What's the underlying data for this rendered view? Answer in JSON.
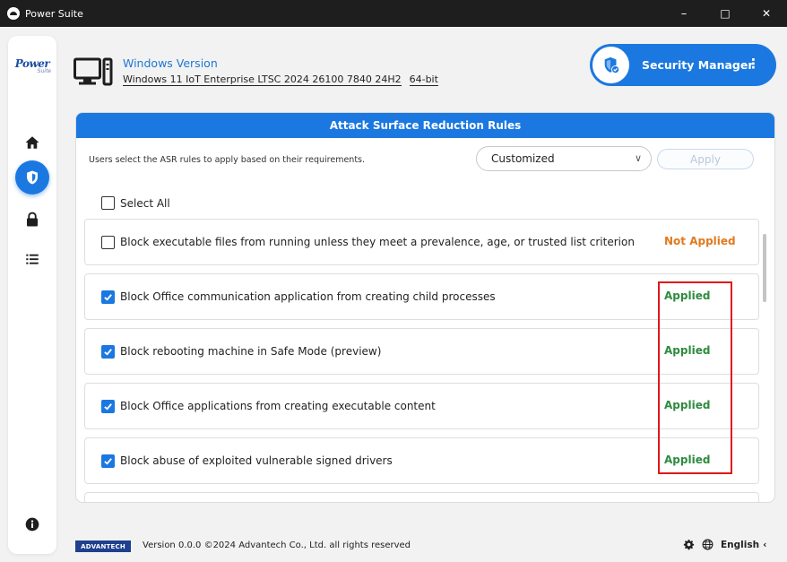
{
  "window": {
    "title": "Power Suite",
    "minimize": "–",
    "maximize": "□",
    "close": "✕"
  },
  "sidebar": {
    "brand": "Power",
    "brand_sub": "Suite",
    "items": [
      {
        "name": "home",
        "icon": "home-icon"
      },
      {
        "name": "security",
        "icon": "shield-icon",
        "active": true
      },
      {
        "name": "lock",
        "icon": "lock-icon"
      },
      {
        "name": "list",
        "icon": "list-icon"
      }
    ],
    "info_icon": "info-icon"
  },
  "header": {
    "windows_version_label": "Windows Version",
    "os_name": "Windows 11 IoT Enterprise LTSC 2024 26100 7840 24H2",
    "arch": "64-bit",
    "security_manager_label": "Security Manager",
    "menu_glyph": "⋮"
  },
  "panel": {
    "title": "Attack Surface Reduction Rules",
    "description": "Users select the ASR rules to apply based on their requirements.",
    "mode": "Customized",
    "mode_chevron": "∨",
    "apply_label": "Apply",
    "select_all_label": "Select All",
    "rules": [
      {
        "label": "Block executable files from running unless they meet a prevalence, age, or trusted list criterion",
        "checked": false,
        "status": "Not Applied"
      },
      {
        "label": "Block Office communication application from creating child processes",
        "checked": true,
        "status": "Applied"
      },
      {
        "label": "Block rebooting machine in Safe Mode (preview)",
        "checked": true,
        "status": "Applied"
      },
      {
        "label": "Block Office applications from creating executable content",
        "checked": true,
        "status": "Applied"
      },
      {
        "label": "Block abuse of exploited vulnerable signed drivers",
        "checked": true,
        "status": "Applied"
      }
    ]
  },
  "footer": {
    "logo_text": "ADVANTECH",
    "version_text": "Version 0.0.0 ©2024 Advantech Co., Ltd. all rights reserved",
    "language": "English",
    "language_chevron": "‹"
  },
  "colors": {
    "accent": "#1b78e0",
    "applied": "#2e8b3e",
    "not_applied": "#e07a1f",
    "highlight": "#e01818",
    "titlebar": "#1e1e1e"
  }
}
